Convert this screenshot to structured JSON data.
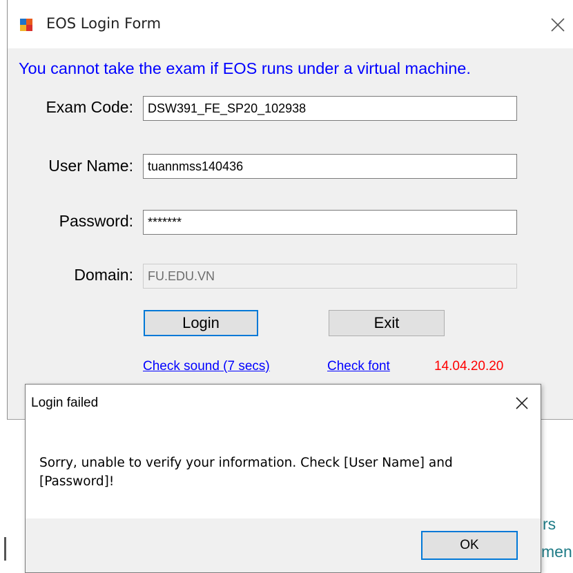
{
  "eos": {
    "title": "EOS Login Form",
    "warning": "You cannot take the exam if EOS runs under a virtual machine.",
    "fields": {
      "exam_code": {
        "label": "Exam Code:",
        "value": "DSW391_FE_SP20_102938"
      },
      "user_name": {
        "label": "User Name:",
        "value": "tuannmss140436"
      },
      "password": {
        "label": "Password:",
        "value": "*******"
      },
      "domain": {
        "label": "Domain:",
        "value": "FU.EDU.VN"
      }
    },
    "buttons": {
      "login": "Login",
      "exit": "Exit"
    },
    "links": {
      "check_sound": "Check sound (7 secs)",
      "check_font": "Check font"
    },
    "version": "14.04.20.20"
  },
  "background": {
    "fragment_1": "rs",
    "fragment_2": "men"
  },
  "dialog": {
    "title": "Login failed",
    "message_line1": "Sorry, unable to verify your information. Check [User Name] and",
    "message_line2": "[Password]!",
    "ok_label": "OK"
  },
  "colors": {
    "warning": "#0000ff",
    "version": "#ff0000",
    "link": "#0000ff",
    "accent": "#0078d7"
  }
}
